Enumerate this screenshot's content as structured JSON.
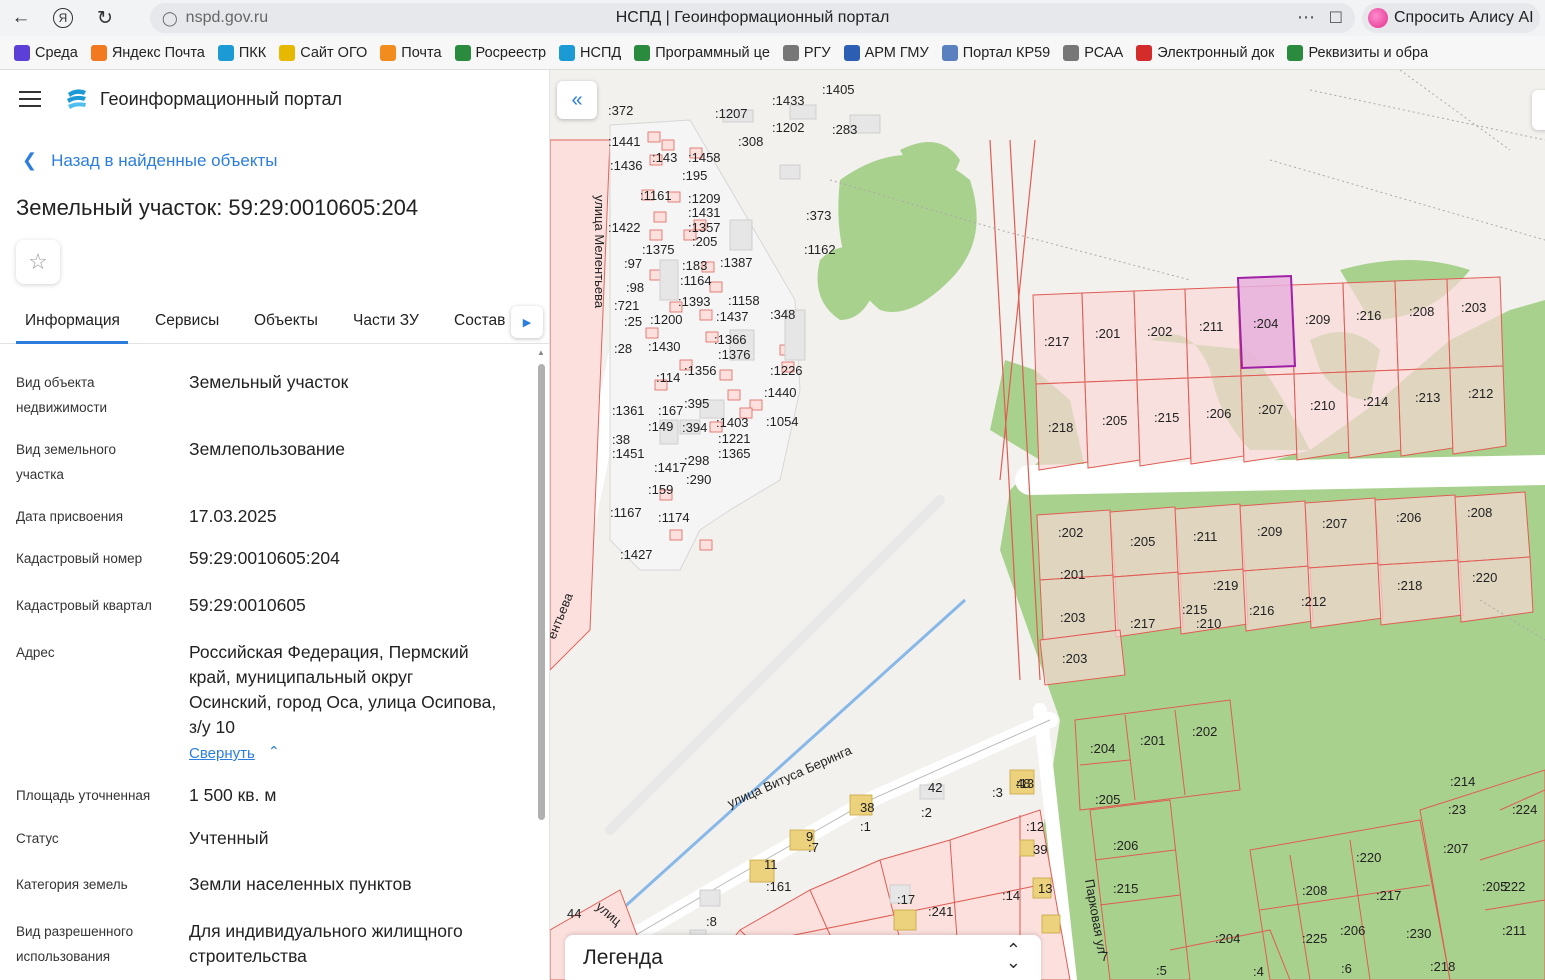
{
  "browser": {
    "url": "nspd.gov.ru",
    "page_title": "НСПД | Геоинформационный портал",
    "alice_label": "Спросить Алису AI",
    "bookmarks": [
      {
        "label": "Среда",
        "color": "#5b3fd6"
      },
      {
        "label": "Яндекс Почта",
        "color": "#f2791f"
      },
      {
        "label": "ПКК",
        "color": "#1b9ad6"
      },
      {
        "label": "Сайт ОГО",
        "color": "#e6b800"
      },
      {
        "label": "Почта",
        "color": "#f28c1f"
      },
      {
        "label": "Росреестр",
        "color": "#2a8a3e"
      },
      {
        "label": "НСПД",
        "color": "#1b9ad6"
      },
      {
        "label": "Программный це",
        "color": "#2a8a3e"
      },
      {
        "label": "РГУ",
        "color": "#777777"
      },
      {
        "label": "АРМ ГМУ",
        "color": "#2c5fb3"
      },
      {
        "label": "Портал КР59",
        "color": "#5a80c0"
      },
      {
        "label": "РСАА",
        "color": "#777777"
      },
      {
        "label": "Электронный док",
        "color": "#d42b2b"
      },
      {
        "label": "Реквизиты и обра",
        "color": "#2a8a3e"
      }
    ]
  },
  "app": {
    "title": "Геоинформационный портал",
    "back_label": "Назад в найденные объекты",
    "object_title": "Земельный участок: 59:29:0010605:204"
  },
  "tabs": [
    "Информация",
    "Сервисы",
    "Объекты",
    "Части ЗУ",
    "Состав"
  ],
  "info": {
    "object_type_label": "Вид объекта недвижимости",
    "object_type": "Земельный участок",
    "land_type_label": "Вид земельного участка",
    "land_type": "Землепользование",
    "date_label": "Дата присвоения",
    "date": "17.03.2025",
    "cad_num_label": "Кадастровый номер",
    "cad_num": "59:29:0010605:204",
    "cad_quarter_label": "Кадастровый квартал",
    "cad_quarter": "59:29:0010605",
    "address_label": "Адрес",
    "address": "Российская Федерация, Пермский край, муниципальный округ Осинский, город Оса, улица Осипова, з/у 10",
    "collapse_label": "Свернуть",
    "area_label": "Площадь уточненная",
    "area": "1 500 кв. м",
    "status_label": "Статус",
    "status": "Учтенный",
    "category_label": "Категория земель",
    "category": "Земли населенных пунктов",
    "permitted_use_label": "Вид разрешенного использования",
    "permitted_use": "Для индивидуального жилищного строительства"
  },
  "map": {
    "legend_label": "Легенда",
    "streets": [
      "улица Мелентьева",
      "ентьева",
      "улица Витуса Беринга",
      "Парковая ул",
      "улиц"
    ],
    "labels": [
      ":372",
      ":1207",
      ":1433",
      ":1405",
      ":1202",
      ":283",
      ":1441",
      ":308",
      ":143",
      ":1458",
      ":1436",
      ":195",
      ":1161",
      ":1209",
      ":1431",
      ":1422",
      ":1357",
      ":1375",
      ":205",
      ":97",
      ":183",
      ":1387",
      ":98",
      ":1164",
      ":1393",
      ":1158",
      ":721",
      ":1437",
      ":348",
      ":25",
      ":1200",
      ":1366",
      ":28",
      ":1430",
      ":1376",
      ":114",
      ":1356",
      ":1226",
      ":1440",
      ":395",
      ":1361",
      ":167",
      ":1403",
      ":1054",
      ":149",
      ":394",
      ":1221",
      ":38",
      ":1451",
      ":1365",
      ":298",
      ":1417",
      ":290",
      ":159",
      ":1167",
      ":1174",
      ":1427",
      ":373",
      ":1162",
      ":217",
      ":201",
      ":202",
      ":211",
      ":204",
      ":209",
      ":216",
      ":208",
      ":203",
      ":218",
      ":205",
      ":215",
      ":206",
      ":207",
      ":210",
      ":214",
      ":213",
      ":212",
      ":202",
      ":205",
      ":211",
      ":209",
      ":207",
      ":206",
      ":208",
      ":201",
      ":219",
      ":218",
      ":220",
      ":203",
      ":210",
      ":215",
      ":217",
      ":216",
      ":212",
      ":203",
      ":204",
      ":201",
      ":202",
      ":205",
      ":206",
      ":215",
      ":214",
      ":23",
      ":224",
      ":207",
      ":220",
      ":205",
      ":208",
      ":217",
      ":222",
      ":225",
      ":206",
      ":230",
      ":211",
      ":204",
      ":218",
      ":6",
      ":5",
      ":4",
      ":3",
      ":2",
      ":1",
      ":7",
      ":161",
      ":8",
      ":13",
      ":12",
      ":14",
      ":17",
      ":241",
      "44",
      "7",
      "42",
      "48",
      "38",
      "9",
      "11",
      "39",
      "13"
    ],
    "accent_color": "#2b7de0",
    "selected_fill": "#e8b0dc",
    "selected_stroke": "#a020a8"
  }
}
